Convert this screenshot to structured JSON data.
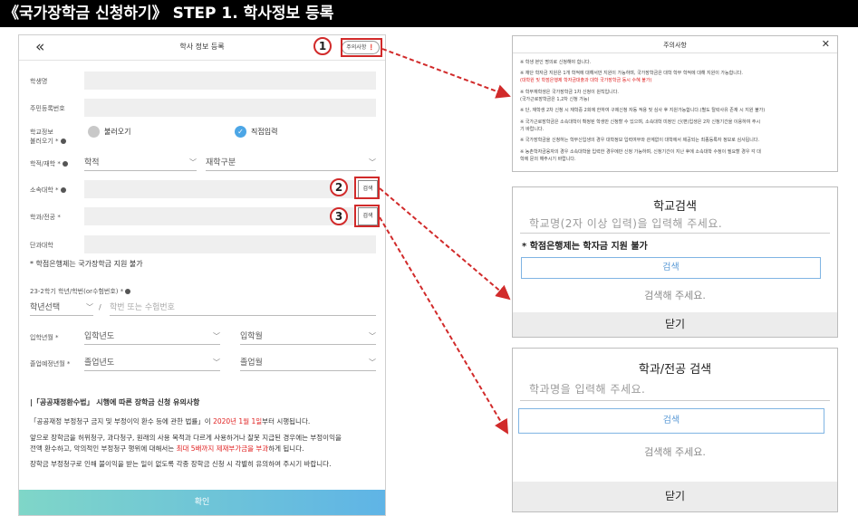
{
  "banner": "《국가장학금 신청하기》 STEP 1. 학사정보 등록",
  "phone": {
    "back_icon": "«",
    "title": "학사 정보 등록",
    "notice_button": "주의사항 ❗",
    "student_name_label": "학생명",
    "rrn_label": "주민등록번호",
    "school_info_label_1": "학교정보",
    "school_info_label_2": "불러오기 *",
    "radio_load": "불러오기",
    "radio_direct": "직접입력",
    "enroll_label": "학적/재학 *",
    "enroll_select": "학적",
    "enroll_type_select": "재학구분",
    "univ_label": "소속대학 *",
    "dept_label": "학과/전공 *",
    "college_label": "단과대학",
    "search_label": "검색",
    "credit_bank_note": "* 학점은행제는 국가장학금 지원 불가",
    "grade_label": "23-2학기 학년/학번(or수험번호) *",
    "grade_select": "학년선택",
    "slash": "/",
    "student_no_placeholder": "학번 또는 수험번호",
    "admission_label": "입학년월 *",
    "admission_year": "입학년도",
    "admission_month": "입학월",
    "grad_label": "졸업예정년월 *",
    "grad_year": "졸업년도",
    "grad_month": "졸업월",
    "law_title": "|「공공재정환수법」 시행에 따른 장학금 신청 유의사항",
    "law_line1_a": "「공공재정 부정청구 금지 및 부정이익 환수 등에 관한 법률」이 ",
    "law_line1_red": "2020년 1월 1일",
    "law_line1_b": "부터 시행됩니다.",
    "law_line2": "앞으로 장학금을 허위청구, 과다청구, 원래의 사용 목적과 다르게 사용하거나 잘못 지급된 경우에는 부정이익을",
    "law_line3_a": "전액 환수하고, 악의적인 부정청구 행위에 대해서는 ",
    "law_line3_red": "최대 5배까지 제재부가금을 부과",
    "law_line3_b": "하게 됩니다.",
    "law_line4": "장학금 부정청구로 인해 불이익을 받는 일이 없도록 각종 장학금 신청 시 각별히 유의하여 주시기 바랍니다.",
    "confirm": "확인"
  },
  "markers": [
    "1",
    "2",
    "3"
  ],
  "notice_panel": {
    "title": "주의사항",
    "close_icon": "✕",
    "lines": [
      {
        "text": "※  학생 본인 명의로 신청해야 합니다.",
        "red": false
      },
      {
        "text": "※  재단 학자금 지원은 1개 학적에 대해서만 지원이 가능하며, 국가장학금은 대학 학부 학적에 대해 지원이 가능합니다.",
        "red": false
      },
      {
        "text": "     (대학원 및 학점은행제 학자금대출과 대학 국가장학금 동시 수혜 불가)",
        "red": true
      },
      {
        "text": "※  학부재학생은 국가장학금 1차 신청이 원칙입니다.",
        "red": false
      },
      {
        "text": "     (국가근로장학금은 1,2차 신청 가능)",
        "red": false
      },
      {
        "text": "※  단, 재학생 2차 신청 시 재학중 2회에 한하여 구제신청 자동 적용 및 심사 후 지원가능합니다.(별도 탈락사유 존재 시 지원 불가)",
        "red": false
      },
      {
        "text": "※  국가근로장학금은 소속대학이 확정된 학생만 신청할 수 있으며, 소속대학 미정인 신(편)입생은 2차 신청기간을 이용하여 주시",
        "red": false
      },
      {
        "text": "     기 바랍니다.",
        "red": false
      },
      {
        "text": "※  국가장학금을 신청하는 학부신입생의 경우 대학정보 입력여부와 관계없이 대학에서 제공되는 최종등록자 정보로 심사됩니다.",
        "red": false
      },
      {
        "text": "※  농촌학자금융자의 경우 소속대학을 입력한 경우에만 신청 가능하며, 신청기간이 지난 후에 소속대학 수정이 필요할 경우 각 대",
        "red": false
      },
      {
        "text": "     학에 문의 해주시기 바랍니다.",
        "red": false
      }
    ]
  },
  "school_panel": {
    "title": "학교검색",
    "placeholder": "학교명(2자 이상 입력)을 입력해 주세요.",
    "warning": "* 학점은행제는 학자금 지원 불가",
    "search": "검색",
    "empty": "검색해 주세요.",
    "close": "닫기"
  },
  "dept_panel": {
    "title": "학과/전공 검색",
    "placeholder": "학과명을 입력해 주세요.",
    "search": "검색",
    "empty": "검색해 주세요.",
    "close": "닫기"
  },
  "colors": {
    "marker_red": "#d12a2a",
    "accent_blue": "#4ca6e6",
    "notice_red": "#e02020"
  }
}
